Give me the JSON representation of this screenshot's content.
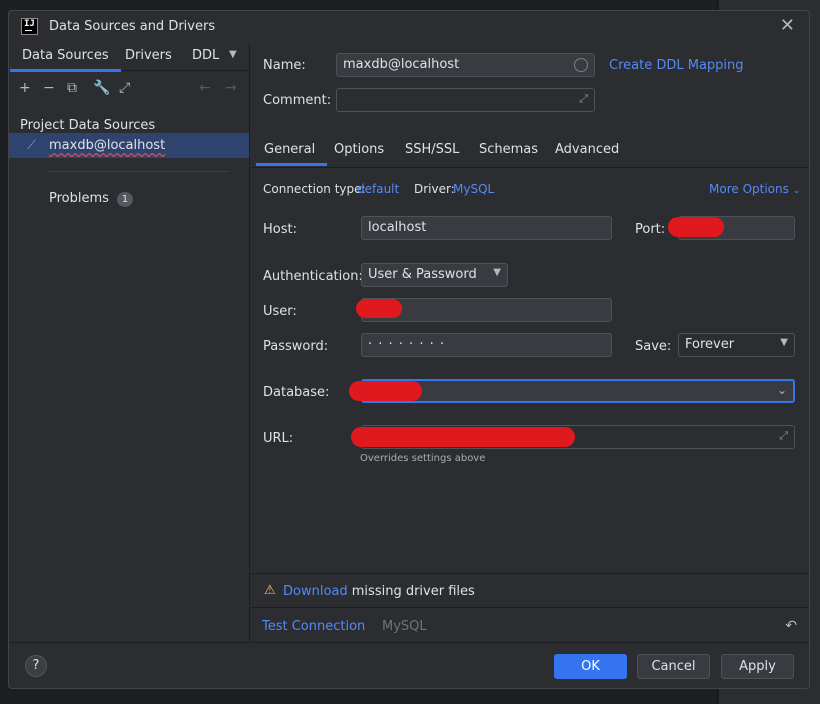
{
  "window": {
    "title": "Data Sources and Drivers",
    "icon_text": "IJ"
  },
  "left": {
    "tabs": [
      "Data Sources",
      "Drivers",
      "DDL"
    ],
    "section_label": "Project Data Sources",
    "item_label": "maxdb@localhost",
    "problems_label": "Problems",
    "problems_count": "1"
  },
  "form": {
    "name_label": "Name:",
    "name_value": "maxdb@localhost",
    "create_ddl_link": "Create DDL Mapping",
    "comment_label": "Comment:",
    "tabs": [
      "General",
      "Options",
      "SSH/SSL",
      "Schemas",
      "Advanced"
    ],
    "conn_type_label": "Connection type:",
    "conn_type_value": "default",
    "driver_label": "Driver:",
    "driver_value": "MySQL",
    "more_options": "More Options",
    "host_label": "Host:",
    "host_value": "localhost",
    "port_label": "Port:",
    "auth_label": "Authentication:",
    "auth_value": "User & Password",
    "user_label": "User:",
    "password_label": "Password:",
    "password_value": "· · · · · · · ·",
    "save_label": "Save:",
    "save_value": "Forever",
    "database_label": "Database:",
    "url_label": "URL:",
    "url_note": "Overrides settings above"
  },
  "warning": {
    "link": "Download",
    "text": "missing driver files"
  },
  "bottom": {
    "test_connection": "Test Connection",
    "driver_name": "MySQL"
  },
  "footer": {
    "help": "?",
    "ok": "OK",
    "cancel": "Cancel",
    "apply": "Apply"
  },
  "colors": {
    "accent": "#3574f0",
    "link": "#548af7",
    "redaction": "#e0191f",
    "warning": "#f2c55c"
  }
}
